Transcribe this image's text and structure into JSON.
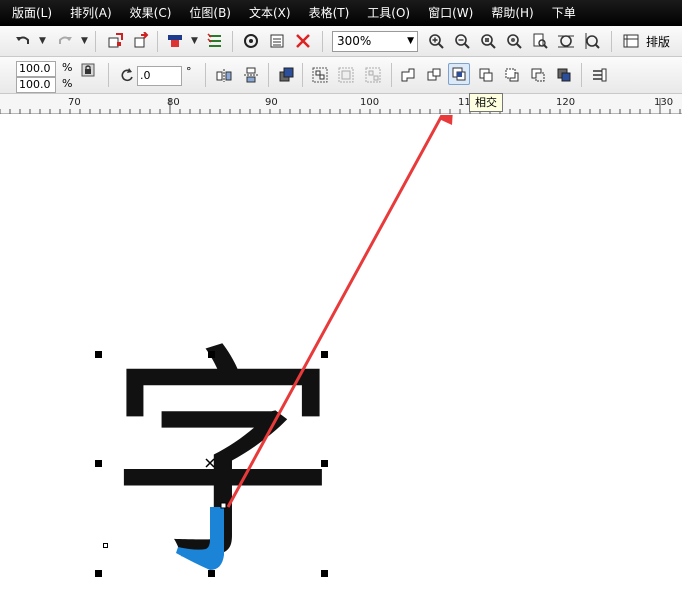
{
  "menu": [
    "版面(L)",
    "排列(A)",
    "效果(C)",
    "位图(B)",
    "文本(X)",
    "表格(T)",
    "工具(O)",
    "窗口(W)",
    "帮助(H)",
    "下单"
  ],
  "toolbar1": {
    "zoom": "300%",
    "layout_label": "排版"
  },
  "toolbar2": {
    "width_value": "100.0",
    "height_value": "100.0",
    "percent_unit": "%",
    "angle_value": ".0",
    "degree_unit": "°"
  },
  "ruler": {
    "labels": [
      "70",
      "80",
      "90",
      "100",
      "11",
      "120",
      "130"
    ]
  },
  "tooltip": "相交",
  "canvas": {
    "glyph": "字"
  },
  "colors": {
    "menubar": "#000000",
    "arrow": "#e83a3a",
    "intersect_fill": "#1b84d6",
    "glyph": "#111111"
  },
  "icons": [
    "undo-icon",
    "redo-icon",
    "import-icon",
    "export-icon",
    "publish-pdf-icon",
    "launcher-icon",
    "options-icon",
    "zoom-in-icon",
    "zoom-out-icon",
    "zoom-selected-icon",
    "zoom-all-icon",
    "zoom-page-icon",
    "zoom-width-icon",
    "zoom-height-icon",
    "lock-ratio-icon",
    "rotate-icon",
    "mirror-h-icon",
    "mirror-v-icon",
    "arrange-icon",
    "group-icon",
    "ungroup-icon",
    "ungroup-all-icon",
    "weld-icon",
    "trim-icon",
    "intersect-icon",
    "simplify-icon",
    "front-minus-back-icon",
    "back-minus-front-icon",
    "boundary-icon",
    "create-boundary-icon"
  ]
}
